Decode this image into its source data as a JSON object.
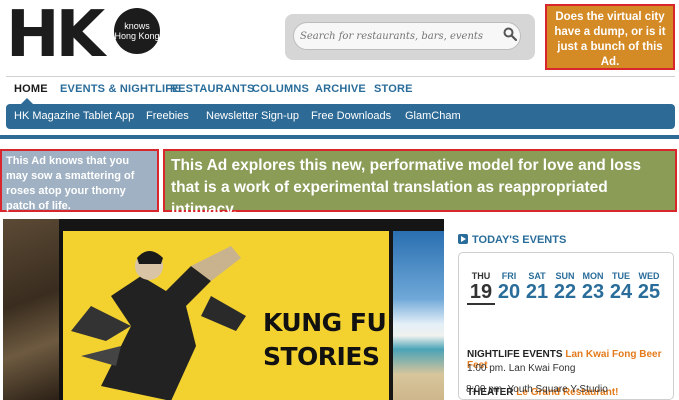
{
  "logo": {
    "letters": "HK",
    "tagline": "knows Hong Kong"
  },
  "search": {
    "placeholder": "Search for restaurants, bars, events"
  },
  "ads": {
    "top_right": "Does the virtual city have a dump, or is it just a bunch of this Ad.",
    "left": "This Ad knows that you may sow a smattering of roses atop your thorny patch of life.",
    "main": "This Ad explores this new, performative model for love and loss that is a work of experimental translation as reappropriated intimacy."
  },
  "main_nav": [
    "HOME",
    "EVENTS & NIGHTLIFE",
    "RESTAURANTS",
    "COLUMNS",
    "ARCHIVE",
    "STORE"
  ],
  "sub_nav": [
    "HK Magazine Tablet App",
    "Freebies",
    "Newsletter Sign-up",
    "Free Downloads",
    "GlamCham"
  ],
  "feature": {
    "title_line1": "KUNG FU",
    "title_line2": "STORIES"
  },
  "events": {
    "header": "TODAY'S EVENTS",
    "days": [
      {
        "name": "THU",
        "num": "19"
      },
      {
        "name": "FRI",
        "num": "20"
      },
      {
        "name": "SAT",
        "num": "21"
      },
      {
        "name": "SUN",
        "num": "22"
      },
      {
        "name": "MON",
        "num": "23"
      },
      {
        "name": "TUE",
        "num": "24"
      },
      {
        "name": "WED",
        "num": "25"
      }
    ],
    "items": [
      {
        "category": "NIGHTLIFE EVENTS",
        "title": "Lan Kwai Fong Beer Fest",
        "detail": "1:00 pm. Lan Kwai Fong"
      },
      {
        "category": "THEATER",
        "title": "Le Grand Restaurant!",
        "detail": "8:00 pm. Youth Square Y-Studio"
      }
    ]
  },
  "colors": {
    "accent": "#2d6a95",
    "event_title": "#e37b1c",
    "ad_border": "#d8262c"
  }
}
